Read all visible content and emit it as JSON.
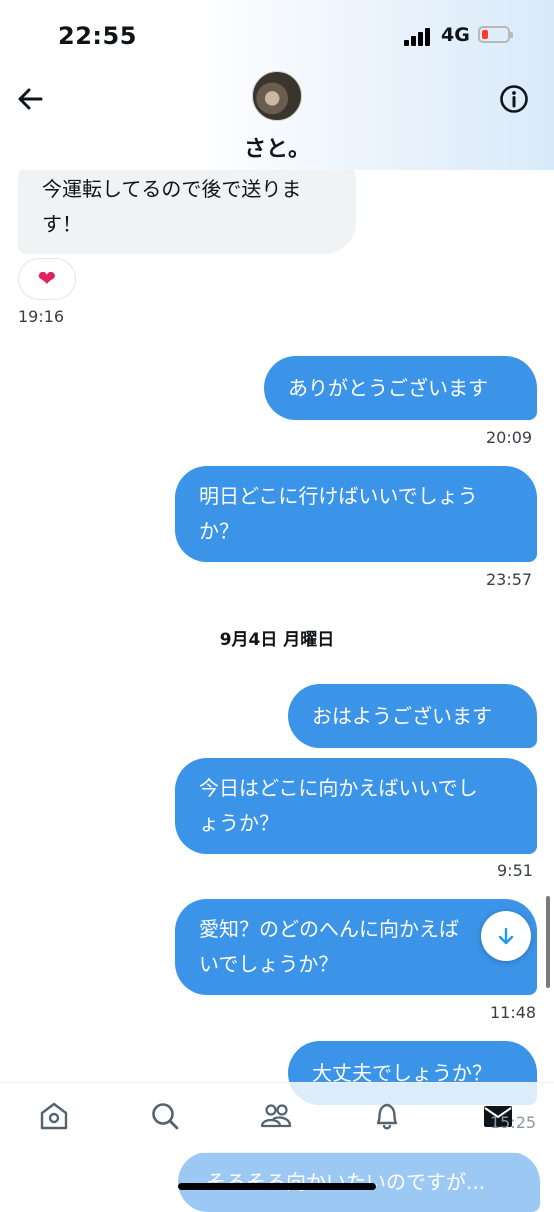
{
  "status": {
    "time": "22:55",
    "network": "4G"
  },
  "header": {
    "name": "さと。"
  },
  "messages": {
    "m1_line1": "今運転してるので後で送りま",
    "m1_line2": "す！",
    "m1_reaction": "❤",
    "m1_time": "19:16",
    "m2": "ありがとうございます",
    "m2_time": "20:09",
    "m3_line1": "明日どこに行けばいいでしょう",
    "m3_line2": "か？",
    "m3_time": "23:57",
    "date": "9月4日 月曜日",
    "m4": "おはようございます",
    "m5_line1": "今日はどこに向かえばいいでし",
    "m5_line2": "ょうか？",
    "m5_time": "9:51",
    "m6_line1": "愛知？のどのへんに向かえば",
    "m6_line2": "いでしょうか？",
    "m6_time": "11:48",
    "m7": "大丈夫でしょうか？",
    "m7_time": "15:25",
    "m8": "そろそろ向かいたいのですが..."
  },
  "icons": [
    "back-arrow-icon",
    "info-icon",
    "heart-icon",
    "arrow-down-icon",
    "home-icon",
    "search-icon",
    "communities-icon",
    "bell-icon",
    "mail-icon"
  ],
  "colors": {
    "outgoing": "#3b94e8",
    "incoming": "#eff3f4",
    "text": "#0f1419"
  }
}
